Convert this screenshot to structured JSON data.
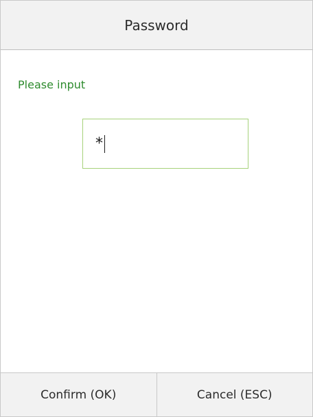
{
  "header": {
    "title": "Password"
  },
  "main": {
    "prompt": "Please input",
    "password_field": {
      "value": "*"
    }
  },
  "footer": {
    "confirm_label": "Confirm (OK)",
    "cancel_label": "Cancel (ESC)"
  },
  "colors": {
    "prompt": "#2e8b2e",
    "field_border": "#a6d27a",
    "bar_background": "#f2f2f2"
  }
}
